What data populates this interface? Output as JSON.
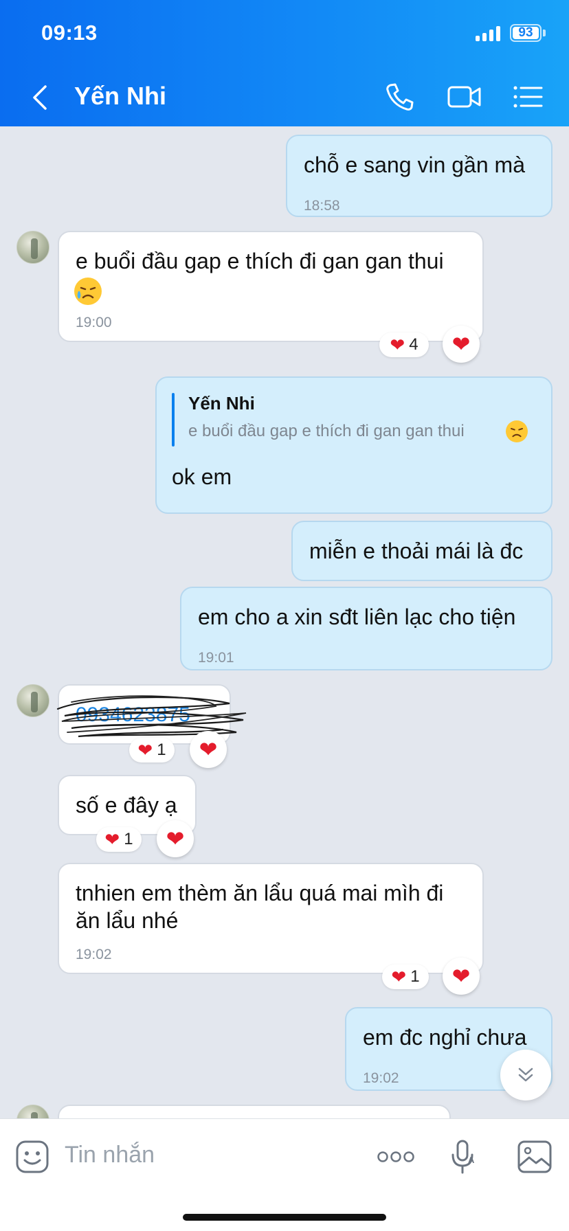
{
  "status_bar": {
    "time": "09:13",
    "battery": "93"
  },
  "header": {
    "contact_name": "Yến Nhi",
    "back_icon": "chevron-left-icon",
    "call_icon": "phone-icon",
    "video_icon": "video-camera-icon",
    "menu_icon": "list-menu-icon"
  },
  "messages": {
    "m1": {
      "text": "chỗ e sang vin gần mà",
      "time": "18:58"
    },
    "m2": {
      "text": "e buổi đầu gap e thích đi gan gan thui",
      "time": "19:00",
      "reaction_count": "4"
    },
    "m3": {
      "quote_author": "Yến Nhi",
      "quote_text": "e buổi đầu gap e thích đi gan gan thui",
      "text": "ok em"
    },
    "m4": {
      "text": "miễn e thoải mái là đc"
    },
    "m5": {
      "text": "em cho a xin sđt liên lạc cho tiện",
      "time": "19:01"
    },
    "m6": {
      "text": "0934623875",
      "reaction_count": "1"
    },
    "m7": {
      "text": "số e đây ạ",
      "reaction_count": "1"
    },
    "m8": {
      "text": "tnhien em thèm ăn lẩu quá mai mìh đi ăn lẩu nhé",
      "time": "19:02",
      "reaction_count": "1"
    },
    "m9": {
      "text": "em đc nghỉ chưa",
      "time": "19:02"
    }
  },
  "input_bar": {
    "placeholder": "Tin nhắn",
    "sticker_icon": "sticker-icon",
    "more_icon": "more-dots-icon",
    "mic_icon": "microphone-icon",
    "image_icon": "image-icon"
  },
  "colors": {
    "header_start": "#0a6df0",
    "header_end": "#19a3f8",
    "outgoing_bubble": "#d4eefc",
    "chat_bg": "#e3e7ee",
    "heart": "#e41c2c"
  }
}
